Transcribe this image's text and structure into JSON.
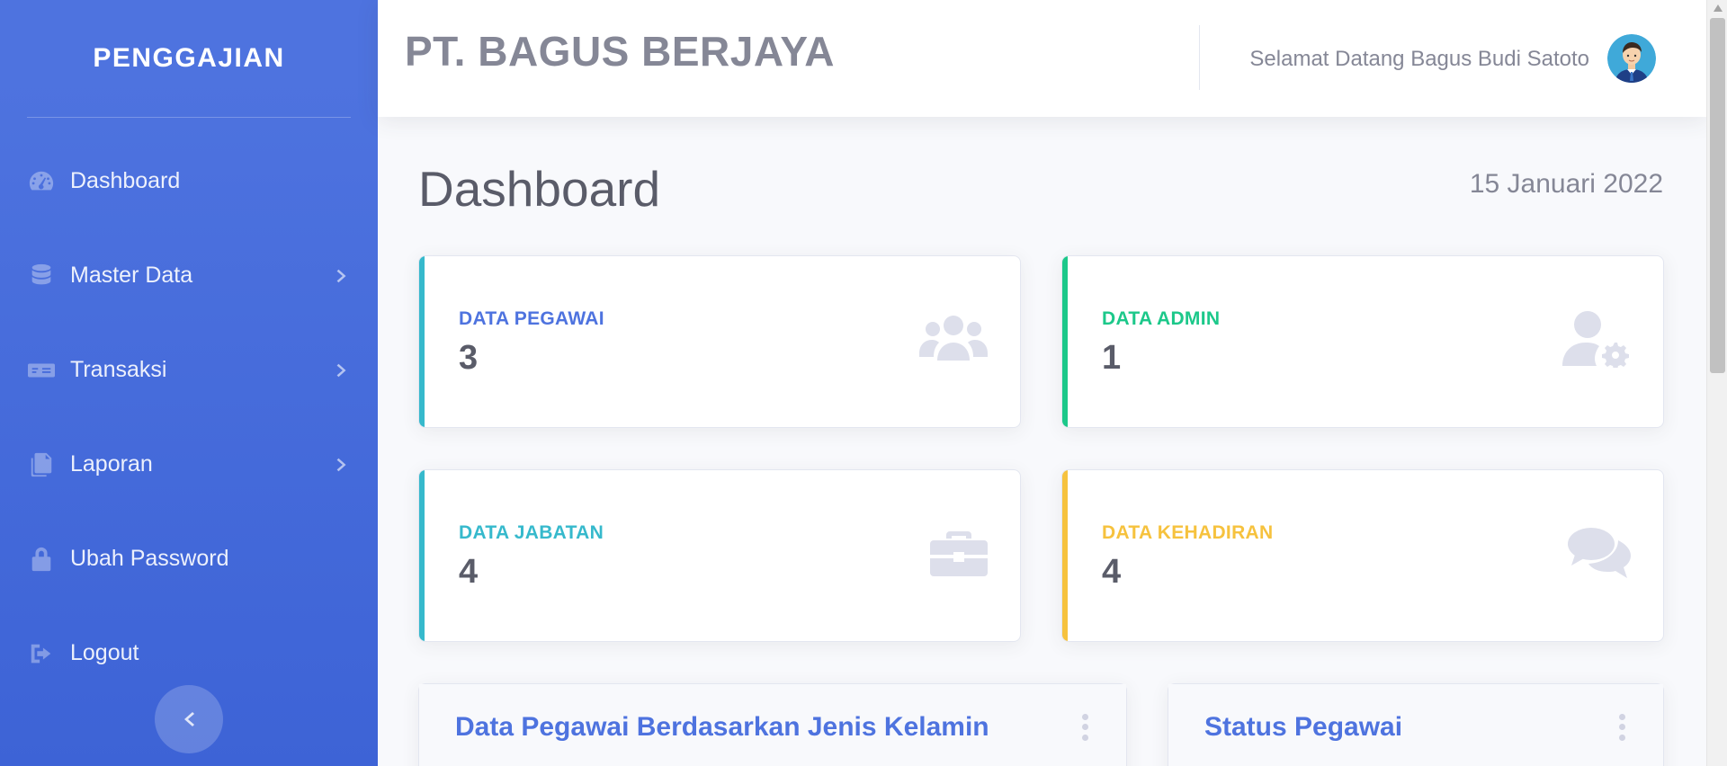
{
  "sidebar": {
    "brand": "PENGGAJIAN",
    "items": [
      {
        "label": "Dashboard",
        "icon": "tachometer-icon",
        "has_submenu": false
      },
      {
        "label": "Master Data",
        "icon": "database-icon",
        "has_submenu": true
      },
      {
        "label": "Transaksi",
        "icon": "money-check-icon",
        "has_submenu": true
      },
      {
        "label": "Laporan",
        "icon": "copy-icon",
        "has_submenu": true
      },
      {
        "label": "Ubah Password",
        "icon": "lock-icon",
        "has_submenu": false
      },
      {
        "label": "Logout",
        "icon": "sign-out-icon",
        "has_submenu": false
      }
    ],
    "toggle_icon": "chevron-left-icon"
  },
  "topbar": {
    "company": "PT. BAGUS BERJAYA",
    "welcome": "Selamat Datang Bagus Budi Satoto",
    "avatar_icon": "user-avatar"
  },
  "page": {
    "title": "Dashboard",
    "date": "15 Januari 2022"
  },
  "cards": [
    {
      "label": "DATA PEGAWAI",
      "value": "3",
      "color": "#4e73df",
      "bar_color": "#36b9cc",
      "icon": "users-icon"
    },
    {
      "label": "DATA ADMIN",
      "value": "1",
      "color": "#1cc88a",
      "bar_color": "#1cc88a",
      "icon": "user-cog-icon"
    },
    {
      "label": "DATA JABATAN",
      "value": "4",
      "color": "#36b9cc",
      "bar_color": "#36b9cc",
      "icon": "briefcase-icon"
    },
    {
      "label": "DATA KEHADIRAN",
      "value": "4",
      "color": "#f6c23e",
      "bar_color": "#f6c23e",
      "icon": "comments-icon"
    }
  ],
  "panels": [
    {
      "title": "Data Pegawai Berdasarkan Jenis Kelamin"
    },
    {
      "title": "Status Pegawai"
    }
  ]
}
